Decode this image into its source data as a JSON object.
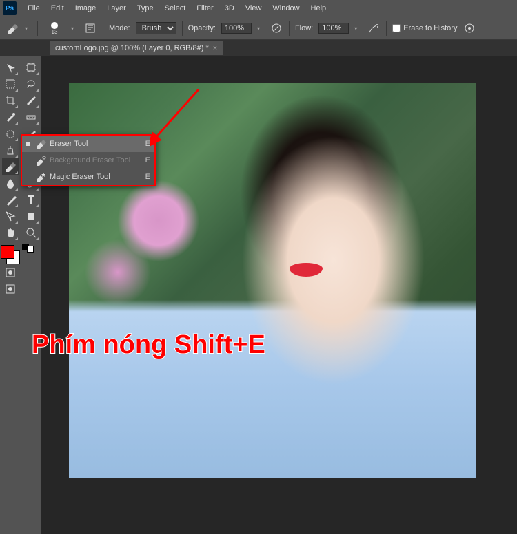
{
  "app": {
    "logo": "Ps"
  },
  "menu": [
    "File",
    "Edit",
    "Image",
    "Layer",
    "Type",
    "Select",
    "Filter",
    "3D",
    "View",
    "Window",
    "Help"
  ],
  "options": {
    "brush_size": "13",
    "mode_label": "Mode:",
    "mode_value": "Brush",
    "opacity_label": "Opacity:",
    "opacity_value": "100%",
    "flow_label": "Flow:",
    "flow_value": "100%",
    "erase_history": "Erase to History"
  },
  "tab": {
    "title": "customLogo.jpg @ 100% (Layer 0, RGB/8#) *"
  },
  "tools_left": [
    {
      "name": "move",
      "glyph": "move"
    },
    {
      "name": "marquee",
      "glyph": "marquee"
    },
    {
      "name": "crop",
      "glyph": "crop"
    },
    {
      "name": "eyedropper",
      "glyph": "eyedropper"
    },
    {
      "name": "patch",
      "glyph": "patch"
    },
    {
      "name": "clone",
      "glyph": "clone"
    },
    {
      "name": "eraser",
      "glyph": "eraser",
      "selected": true
    },
    {
      "name": "blur",
      "glyph": "blur"
    },
    {
      "name": "pen",
      "glyph": "pen"
    },
    {
      "name": "path-sel",
      "glyph": "path"
    },
    {
      "name": "hand",
      "glyph": "hand"
    }
  ],
  "tools_right": [
    {
      "name": "artboard",
      "glyph": "artboard"
    },
    {
      "name": "lasso",
      "glyph": "lasso"
    },
    {
      "name": "slice",
      "glyph": "slice"
    },
    {
      "name": "ruler",
      "glyph": "ruler"
    },
    {
      "name": "brush",
      "glyph": "brush"
    },
    {
      "name": "history",
      "glyph": "history"
    },
    {
      "name": "bucket",
      "glyph": "bucket"
    },
    {
      "name": "dodge",
      "glyph": "dodge"
    },
    {
      "name": "type",
      "glyph": "type"
    },
    {
      "name": "shape",
      "glyph": "shape"
    },
    {
      "name": "zoom",
      "glyph": "zoom"
    }
  ],
  "flyout": [
    {
      "label": "Eraser Tool",
      "shortcut": "E",
      "selected": true,
      "icon": "eraser"
    },
    {
      "label": "Background Eraser Tool",
      "shortcut": "E",
      "dim": true,
      "icon": "bg-eraser"
    },
    {
      "label": "Magic Eraser Tool",
      "shortcut": "E",
      "icon": "magic-eraser"
    }
  ],
  "caption": "Phím nóng Shift+E",
  "colors": {
    "fg": "#ff0000",
    "bg": "#ffffff"
  }
}
